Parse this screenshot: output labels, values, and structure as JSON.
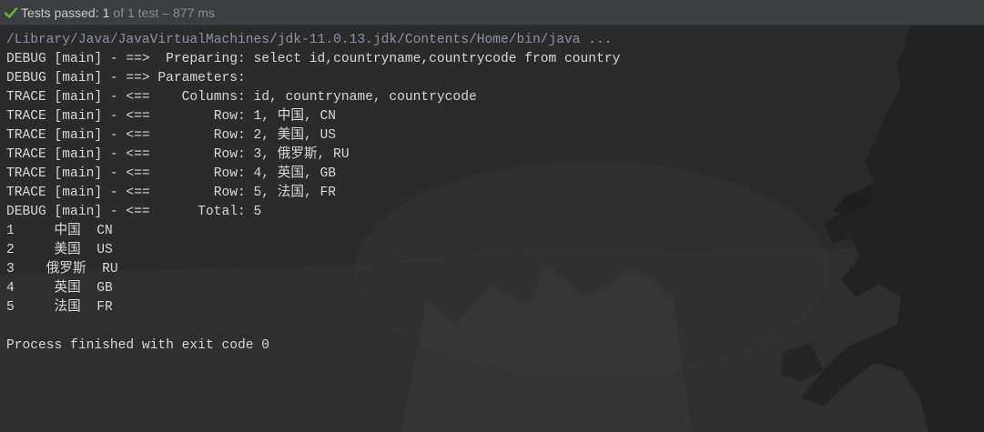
{
  "status": {
    "label": "Tests passed:",
    "count": "1",
    "of_text": "of 1 test",
    "dash": "–",
    "time": "877 ms"
  },
  "console": {
    "command": "/Library/Java/JavaVirtualMachines/jdk-11.0.13.jdk/Contents/Home/bin/java ...",
    "log_lines": [
      "DEBUG [main] - ==>  Preparing: select id,countryname,countrycode from country",
      "DEBUG [main] - ==> Parameters: ",
      "TRACE [main] - <==    Columns: id, countryname, countrycode",
      "TRACE [main] - <==        Row: 1, 中国, CN",
      "TRACE [main] - <==        Row: 2, 美国, US",
      "TRACE [main] - <==        Row: 3, 俄罗斯, RU",
      "TRACE [main] - <==        Row: 4, 英国, GB",
      "TRACE [main] - <==        Row: 5, 法国, FR",
      "DEBUG [main] - <==      Total: 5"
    ],
    "output_lines": [
      "1     中国  CN",
      "2     美国  US",
      "3    俄罗斯  RU",
      "4     英国  GB",
      "5     法国  FR"
    ],
    "exit_message": "Process finished with exit code 0"
  },
  "colors": {
    "background": "#2b2b2b",
    "status_bar": "#3c3f41",
    "pass_check": "#5fb832",
    "text": "#d8d8d8",
    "command": "#8a93a8"
  },
  "icons": {
    "status": "check-icon"
  }
}
